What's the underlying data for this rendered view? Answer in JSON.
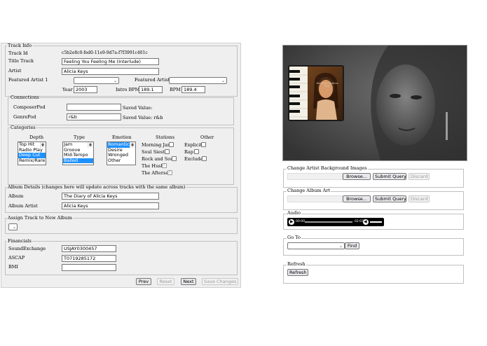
{
  "track_info": {
    "legend": "Track Info",
    "track_id_label": "Track Id",
    "track_id": "c5b2e8c0-fed0-11e9-9d7a-f7f3991c401c",
    "title_label": "Title Track",
    "title": "Feeling You Feeling Me (Interlude)",
    "artist_label": "Artist",
    "artist": "Alicia Keys",
    "featured1_label": "Featured Artist 1",
    "featured1": "",
    "featured2_label": "Featured Artist 2",
    "featured2": "",
    "year_label": "Year",
    "year": "2003",
    "intro_bpm_label": "Intro BPM",
    "intro_bpm": "189.1",
    "bpm_label": "BPM",
    "bpm": "189.4"
  },
  "connections": {
    "legend": "Connections",
    "composer_label": "ComposerPod",
    "composer": "",
    "composer_saved": "Saved Value:",
    "genre_label": "GenrePod",
    "genre": "r&b",
    "genre_saved": "Saved Value: r&b"
  },
  "categories": {
    "legend": "Categories",
    "depth_label": "Depth",
    "depth_options": [
      "Top Hit",
      "Radio Play",
      "Deep Cut",
      "Remix/Rare"
    ],
    "type_label": "Type",
    "type_options": [
      "Jam",
      "Groove",
      "Mid-Tempo",
      "Balled"
    ],
    "emotion_label": "Emotion",
    "emotion_options": [
      "Romantic",
      "Desire",
      "Wronged",
      "Other"
    ],
    "stations_label": "Stations",
    "stations": [
      "Morning Jam",
      "Soul Siesta",
      "Rock and Soul",
      "The Hush",
      "The Afterset"
    ],
    "other_label": "Other",
    "other": [
      "Explicit",
      "Rap",
      "Exclude"
    ]
  },
  "album_details": {
    "legend": "Album Details (changes here will update across tracks with the same album)",
    "album_label": "Album",
    "album": "The Diary of Alicia Keys",
    "album_artist_label": "Album Artist",
    "album_artist": "Alicia Keys"
  },
  "assign": {
    "legend": "Assign Track to New Album"
  },
  "financials": {
    "legend": "Financials",
    "soundexchange_label": "SoundExchange",
    "soundexchange": "USJAY0300457",
    "ascap_label": "ASCAP",
    "ascap": "T0719285172",
    "bmi_label": "BMI",
    "bmi": ""
  },
  "nav_buttons": {
    "prev": "Prev",
    "reset": "Reset",
    "next": "Next",
    "save": "Save Changes"
  },
  "right": {
    "bg_legend": "Change Artist Background Images",
    "art_legend": "Change Album Art",
    "browse": "Browse...",
    "submit": "Submit Query",
    "discard": "Discard",
    "audio_legend": "Audio",
    "audio_time_current": "00:00",
    "audio_time_total": "02:07",
    "goto_legend": "Go To",
    "find": "Find",
    "refresh_legend": "Refresh",
    "refresh": "Refresh"
  },
  "album_art": {
    "caption": "the diary of alicia keys"
  },
  "colors": {
    "selected": "#1e90ff",
    "panel": "#efefef",
    "player": "#000000"
  }
}
